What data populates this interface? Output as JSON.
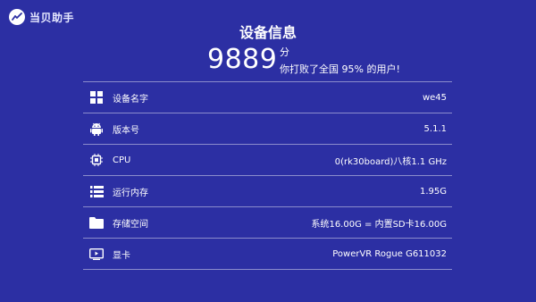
{
  "app": {
    "logo_text": "当贝助手"
  },
  "header": {
    "title": "设备信息",
    "score": "9889",
    "score_unit": "分",
    "score_desc": "你打败了全国 95% 的用户!"
  },
  "rows": [
    {
      "icon": "windows-grid-icon",
      "label": "设备名字",
      "value": "we45"
    },
    {
      "icon": "android-icon",
      "label": "版本号",
      "value": "5.1.1"
    },
    {
      "icon": "cpu-chip-icon",
      "label": "CPU",
      "value": "0(rk30board)八核1.1 GHz"
    },
    {
      "icon": "memory-list-icon",
      "label": "运行内存",
      "value": "1.95G"
    },
    {
      "icon": "folder-icon",
      "label": "存储空间",
      "value": "系统16.00G = 内置SD卡16.00G"
    },
    {
      "icon": "display-icon",
      "label": "显卡",
      "value": "PowerVR Rogue G611032"
    }
  ],
  "colors": {
    "background": "#2c2fa3",
    "divider": "#b8b9e6",
    "text": "#ffffff"
  }
}
